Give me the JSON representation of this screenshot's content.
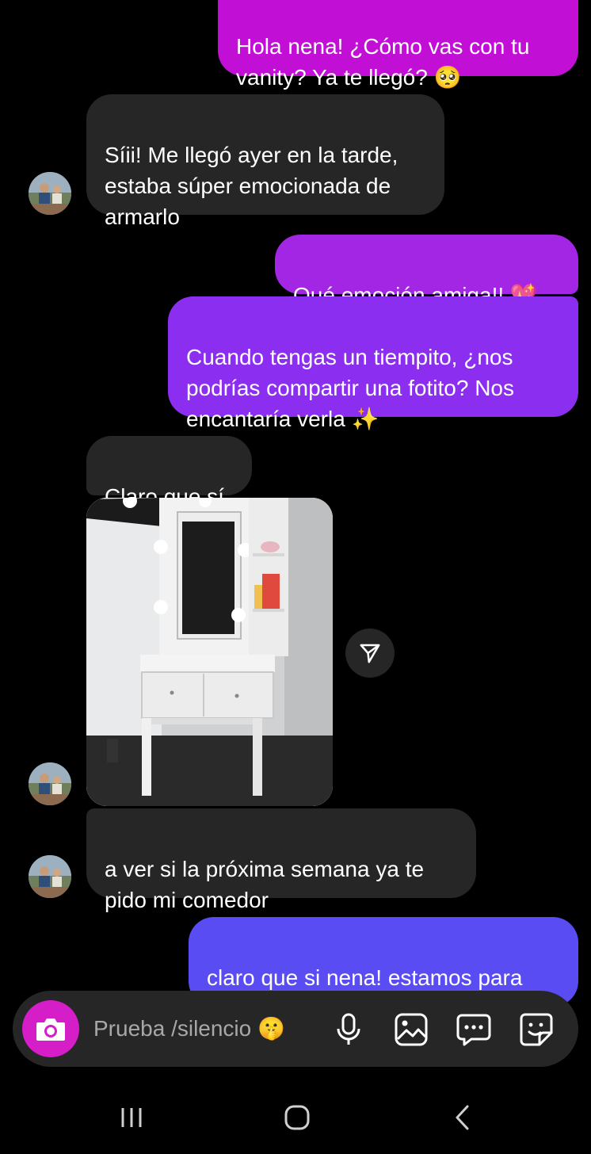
{
  "messages": [
    {
      "id": "m1",
      "side": "out",
      "text": "Hola nena! ¿Cómo vas con tu\nvanity? Ya te llegó? 🥺"
    },
    {
      "id": "m2",
      "side": "in",
      "text": "Síii! Me llegó ayer en la tarde,\nestaba súper emocionada de\narmarlo"
    },
    {
      "id": "m3",
      "side": "out",
      "text": "Qué emoción amiga!! 💖"
    },
    {
      "id": "m4",
      "side": "out",
      "text": "Cuando tengas un tiempito, ¿nos\npodrías compartir una fotito? Nos\nencantaría verla ✨"
    },
    {
      "id": "m5",
      "side": "in",
      "text": "Claro que sí"
    },
    {
      "id": "m6",
      "side": "in",
      "type": "photo",
      "description": "vanity"
    },
    {
      "id": "m7",
      "side": "in",
      "text": "a ver si la próxima semana ya te\npido mi comedor"
    },
    {
      "id": "m8",
      "side": "out",
      "text": "claro que si nena! estamos para\nservirte"
    }
  ],
  "composer": {
    "placeholder": "Prueba /silencio 🤫",
    "icons": [
      "camera-icon",
      "microphone-icon",
      "gallery-icon",
      "chat-icon",
      "sticker-icon"
    ]
  },
  "nav": {
    "icons": [
      "recent-apps-icon",
      "home-icon",
      "back-icon"
    ]
  },
  "colors": {
    "bubble_in": "#262626",
    "bubble_out_top": "#c10fd6",
    "bubble_out_mid": "#8c2ef0",
    "bubble_out_bottom": "#5a4cf3",
    "camera_button": "#d51ec8"
  }
}
